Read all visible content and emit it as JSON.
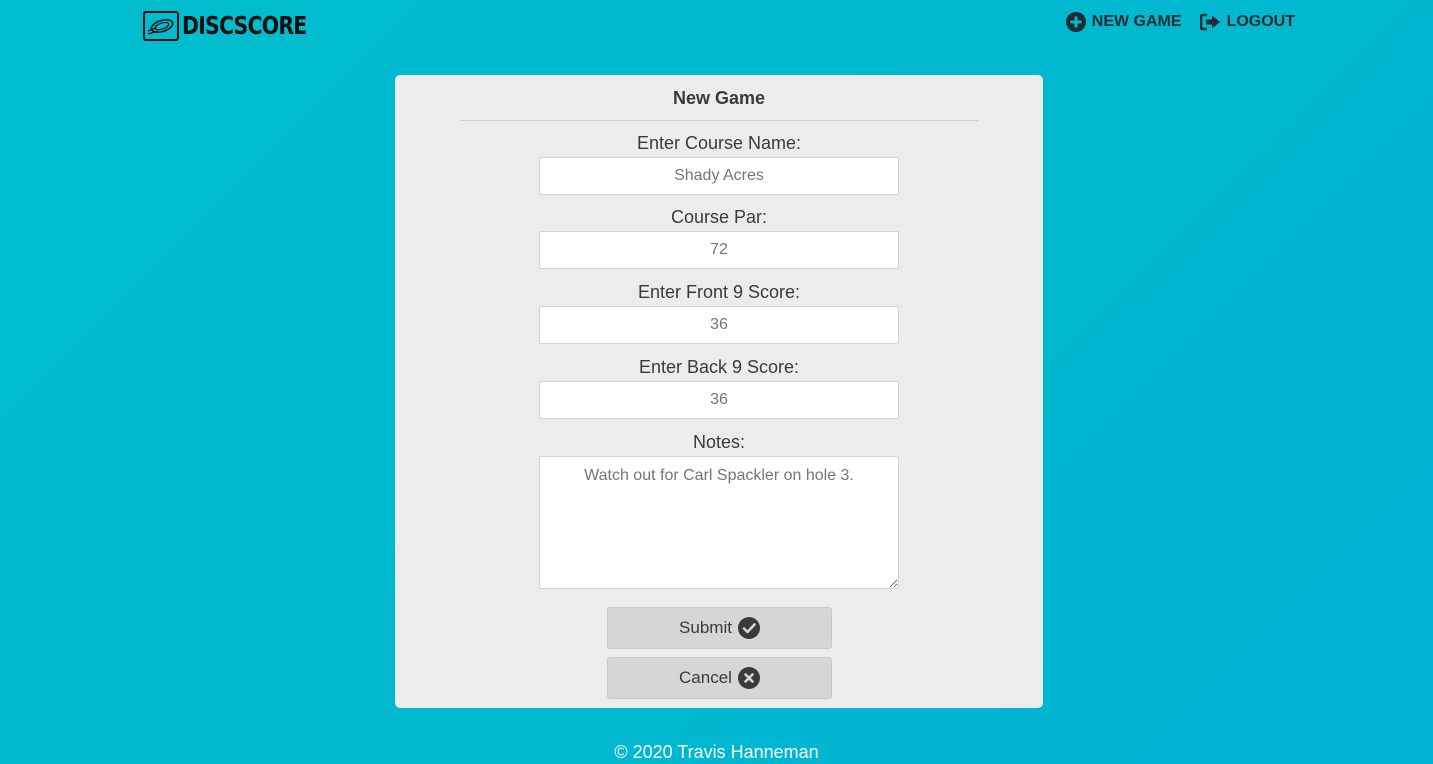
{
  "brand": {
    "name": "DISCSCORE"
  },
  "nav": {
    "new_game_label": "NEW GAME",
    "logout_label": "LOGOUT"
  },
  "form": {
    "title": "New Game",
    "course_name": {
      "label": "Enter Course Name:",
      "placeholder": "Shady Acres"
    },
    "course_par": {
      "label": "Course Par:",
      "placeholder": "72"
    },
    "front_nine": {
      "label": "Enter Front 9 Score:",
      "placeholder": "36"
    },
    "back_nine": {
      "label": "Enter Back 9 Score:",
      "placeholder": "36"
    },
    "notes": {
      "label": "Notes:",
      "placeholder": "Watch out for Carl Spackler on hole 3."
    },
    "submit_label": "Submit",
    "cancel_label": "Cancel"
  },
  "footer": {
    "text": "© 2020 Travis Hanneman"
  },
  "icons": {
    "logo": "disc-icon",
    "new_game": "plus-circle-icon",
    "logout": "sign-out-icon",
    "submit": "check-circle-icon",
    "cancel": "times-circle-icon"
  },
  "colors": {
    "background": "#00bacf",
    "card": "#ececec",
    "button": "#d6d6d6",
    "nav_text": "#1d2b33",
    "footer_text": "#ffffff"
  }
}
